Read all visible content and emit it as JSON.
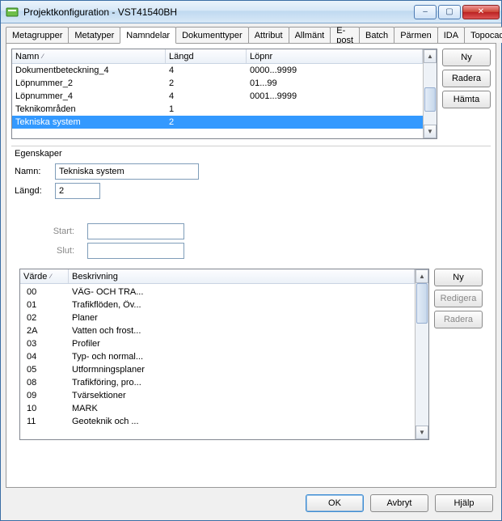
{
  "window": {
    "title": "Projektkonfiguration - VST41540BH"
  },
  "tabs": [
    "Metagrupper",
    "Metatyper",
    "Namndelar",
    "Dokumenttyper",
    "Attribut",
    "Allmänt",
    "E-post",
    "Batch",
    "Pärmen",
    "IDA",
    "Topocad"
  ],
  "activeTab": "Namndelar",
  "upper": {
    "columns": {
      "namn": "Namn",
      "langd": "Längd",
      "lopnr": "Löpnr"
    },
    "rows": [
      {
        "namn": "Dokumentbeteckning_4",
        "langd": "4",
        "lopnr": "0000...9999"
      },
      {
        "namn": "Löpnummer_2",
        "langd": "2",
        "lopnr": "01...99"
      },
      {
        "namn": "Löpnummer_4",
        "langd": "4",
        "lopnr": "0001...9999"
      },
      {
        "namn": "Teknikområden",
        "langd": "1",
        "lopnr": ""
      },
      {
        "namn": "Tekniska system",
        "langd": "2",
        "lopnr": ""
      }
    ],
    "selectedIndex": 4,
    "buttons": {
      "ny": "Ny",
      "radera": "Radera",
      "hamta": "Hämta"
    }
  },
  "properties": {
    "groupTitle": "Egenskaper",
    "labels": {
      "namn": "Namn:",
      "langd": "Längd:",
      "start": "Start:",
      "slut": "Slut:"
    },
    "values": {
      "namn": "Tekniska system",
      "langd": "2",
      "start": "",
      "slut": ""
    }
  },
  "values": {
    "columns": {
      "varde": "Värde",
      "beskrivning": "Beskrivning"
    },
    "rows": [
      {
        "v": "00",
        "b": "VÄG‑ OCH TRA..."
      },
      {
        "v": "01",
        "b": "Trafikflöden, Öv..."
      },
      {
        "v": "02",
        "b": "Planer"
      },
      {
        "v": "2A",
        "b": "Vatten och frost..."
      },
      {
        "v": "03",
        "b": "Profiler"
      },
      {
        "v": "04",
        "b": "Typ- och normal..."
      },
      {
        "v": "05",
        "b": "Utformningsplaner"
      },
      {
        "v": "08",
        "b": "Trafikföring, pro..."
      },
      {
        "v": "09",
        "b": "Tvärsektioner"
      },
      {
        "v": "10",
        "b": "MARK"
      },
      {
        "v": "11",
        "b": "Geoteknik och ..."
      }
    ],
    "buttons": {
      "ny": "Ny",
      "redigera": "Redigera",
      "radera": "Radera"
    }
  },
  "dialogButtons": {
    "ok": "OK",
    "avbryt": "Avbryt",
    "hjalp": "Hjälp"
  }
}
